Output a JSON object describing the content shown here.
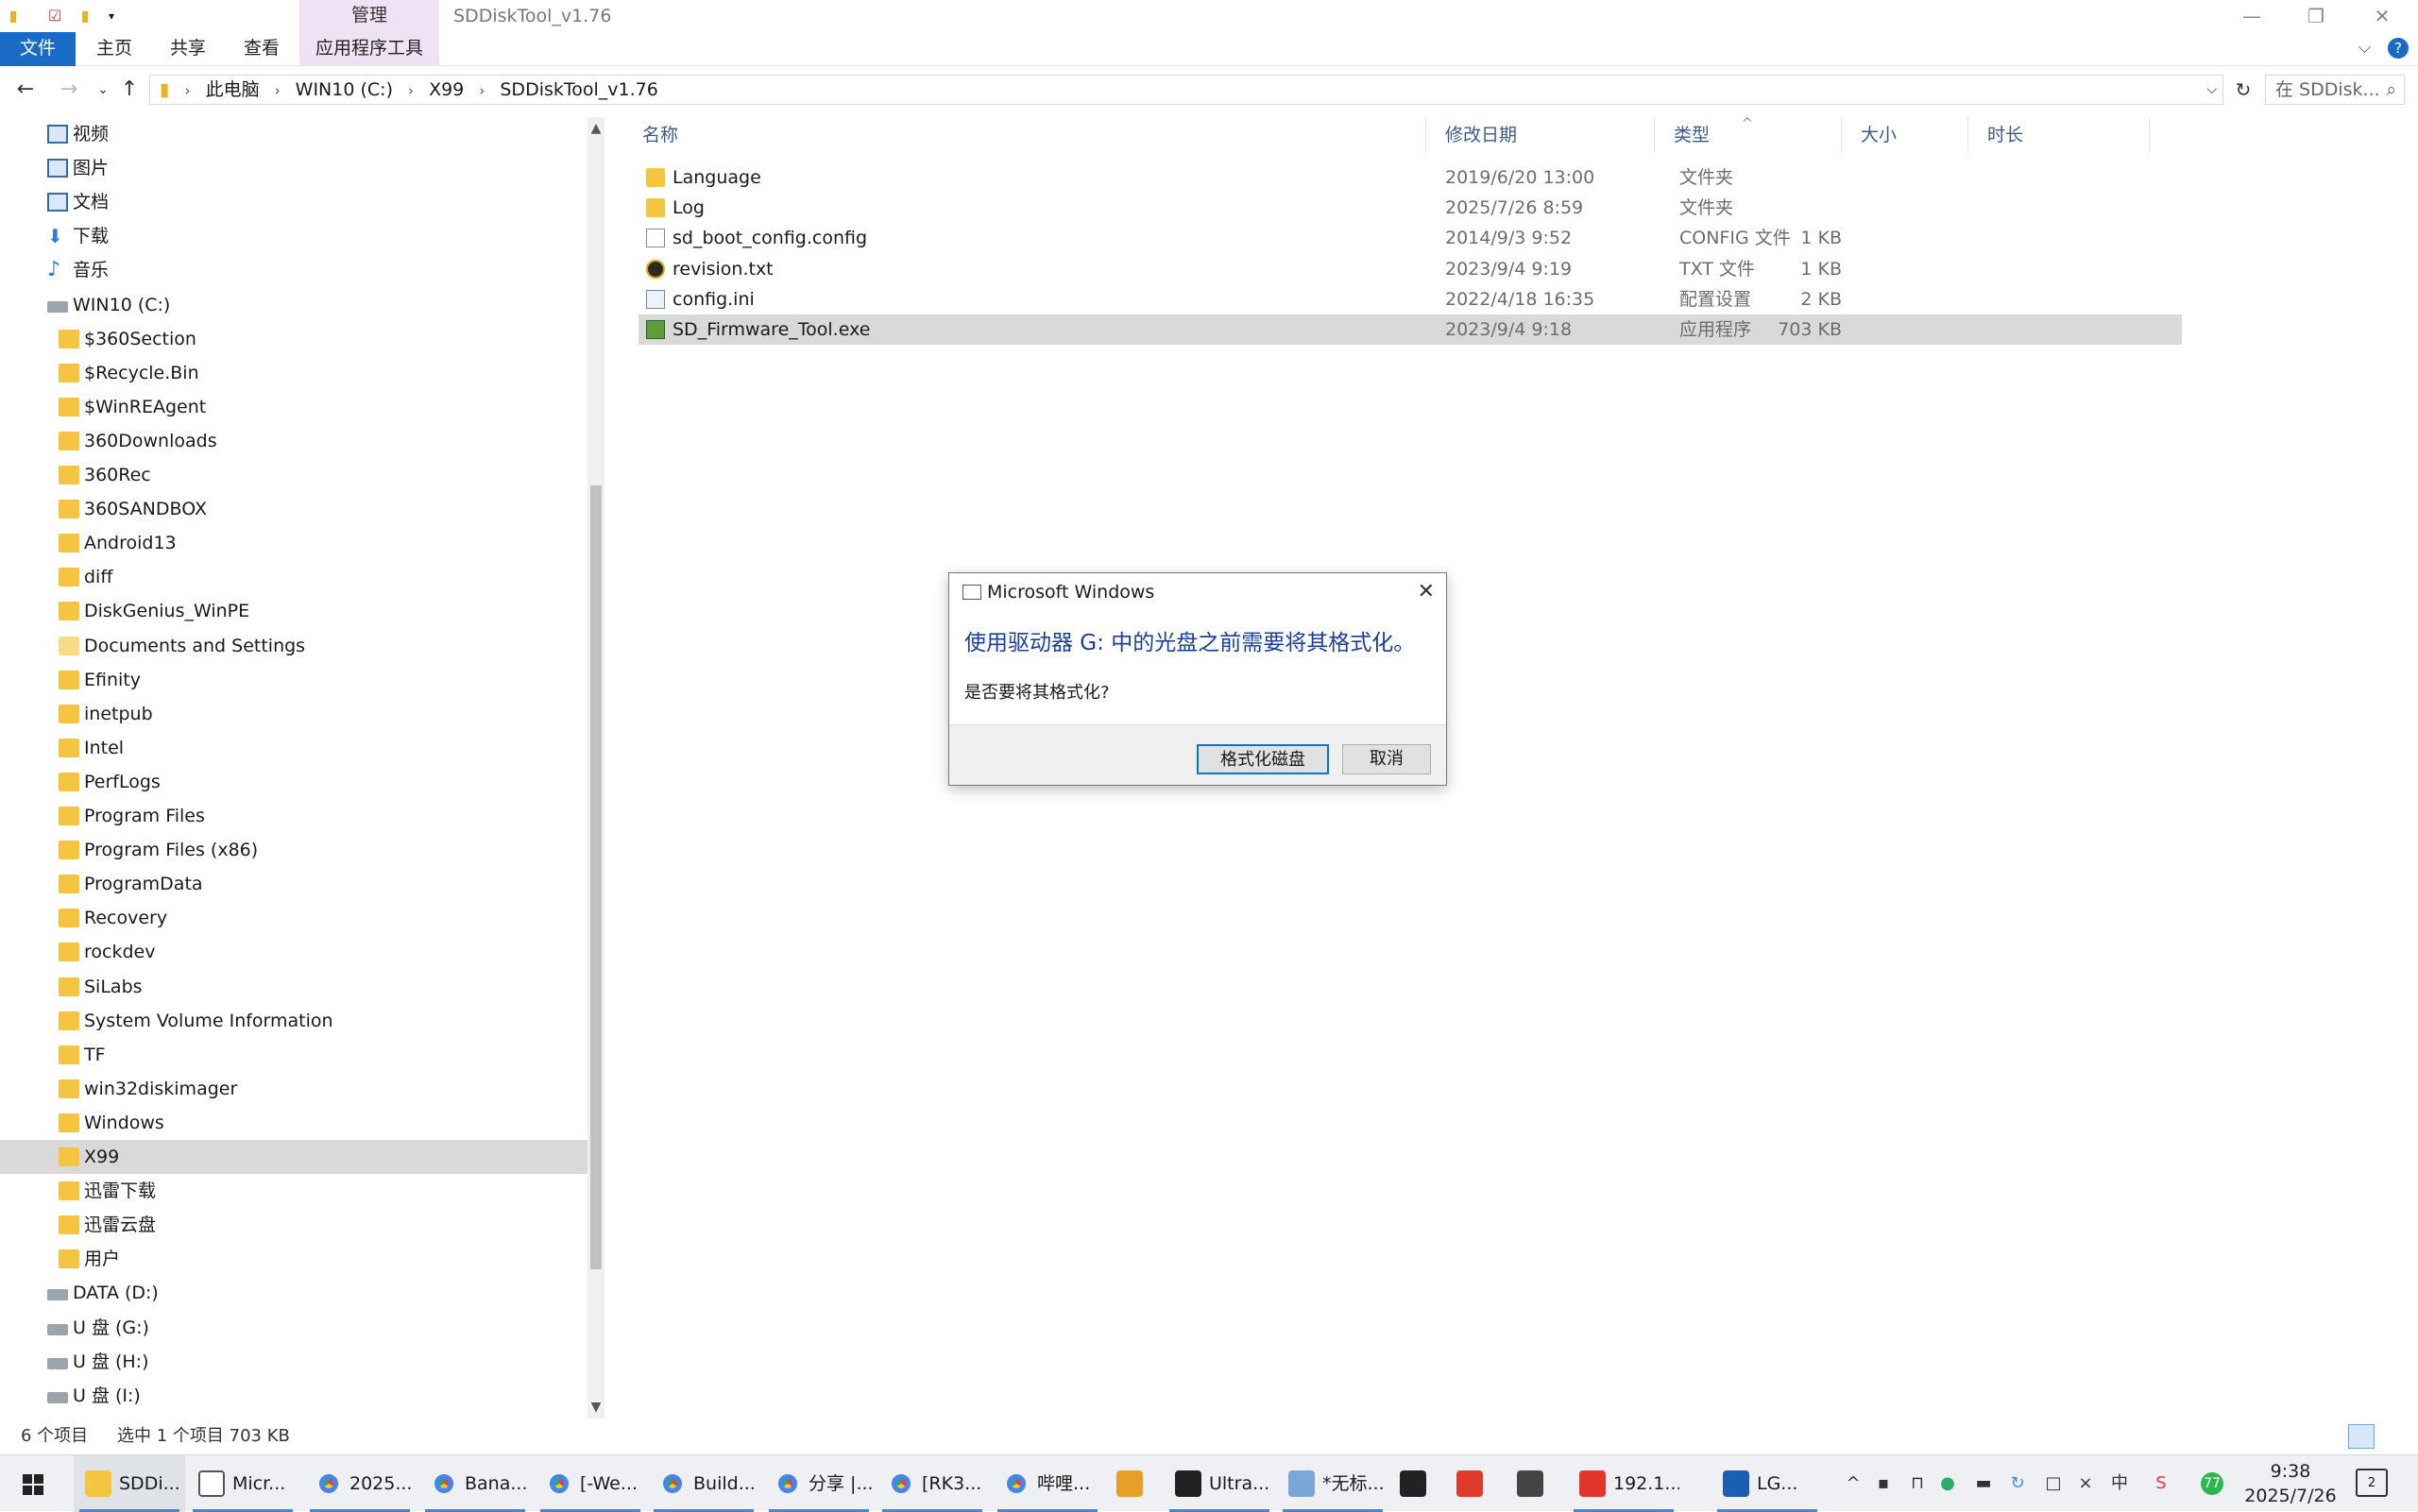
{
  "window": {
    "title": "SDDiskTool_v1.76",
    "manage_tab": "管理",
    "controls": {
      "minimize": "—",
      "restore": "❐",
      "close": "✕"
    }
  },
  "ribbon": {
    "tabs": [
      "文件",
      "主页",
      "共享",
      "查看",
      "应用程序工具"
    ],
    "expand": "⌵",
    "help": "?"
  },
  "address": {
    "crumbs": [
      "此电脑",
      "WIN10 (C:)",
      "X99",
      "SDDiskTool_v1.76"
    ],
    "search_placeholder": "在 SDDisk...",
    "refresh": "↻"
  },
  "navpane": {
    "items": [
      {
        "label": "视频",
        "icon": "library-video-icon",
        "indent": 1
      },
      {
        "label": "图片",
        "icon": "library-pictures-icon",
        "indent": 1
      },
      {
        "label": "文档",
        "icon": "library-documents-icon",
        "indent": 1
      },
      {
        "label": "下载",
        "icon": "download-arrow-icon",
        "indent": 1
      },
      {
        "label": "音乐",
        "icon": "music-note-icon",
        "indent": 1
      },
      {
        "label": "WIN10 (C:)",
        "icon": "windows-drive-icon",
        "indent": 1
      },
      {
        "label": "$360Section",
        "icon": "folder-icon",
        "indent": 2
      },
      {
        "label": "$Recycle.Bin",
        "icon": "folder-icon",
        "indent": 2
      },
      {
        "label": "$WinREAgent",
        "icon": "folder-icon",
        "indent": 2
      },
      {
        "label": "360Downloads",
        "icon": "folder-icon",
        "indent": 2
      },
      {
        "label": "360Rec",
        "icon": "folder-icon",
        "indent": 2
      },
      {
        "label": "360SANDBOX",
        "icon": "folder-icon",
        "indent": 2
      },
      {
        "label": "Android13",
        "icon": "folder-icon",
        "indent": 2
      },
      {
        "label": "diff",
        "icon": "folder-icon",
        "indent": 2
      },
      {
        "label": "DiskGenius_WinPE",
        "icon": "folder-icon",
        "indent": 2
      },
      {
        "label": "Documents and Settings",
        "icon": "shortcut-folder-icon",
        "indent": 2
      },
      {
        "label": "Efinity",
        "icon": "folder-icon",
        "indent": 2
      },
      {
        "label": "inetpub",
        "icon": "folder-icon",
        "indent": 2
      },
      {
        "label": "Intel",
        "icon": "folder-icon",
        "indent": 2
      },
      {
        "label": "PerfLogs",
        "icon": "folder-icon",
        "indent": 2
      },
      {
        "label": "Program Files",
        "icon": "folder-icon",
        "indent": 2
      },
      {
        "label": "Program Files (x86)",
        "icon": "folder-icon",
        "indent": 2
      },
      {
        "label": "ProgramData",
        "icon": "folder-icon",
        "indent": 2
      },
      {
        "label": "Recovery",
        "icon": "folder-icon",
        "indent": 2
      },
      {
        "label": "rockdev",
        "icon": "folder-icon",
        "indent": 2
      },
      {
        "label": "SiLabs",
        "icon": "folder-icon",
        "indent": 2
      },
      {
        "label": "System Volume Information",
        "icon": "folder-icon",
        "indent": 2
      },
      {
        "label": "TF",
        "icon": "folder-icon",
        "indent": 2
      },
      {
        "label": "win32diskimager",
        "icon": "folder-icon",
        "indent": 2
      },
      {
        "label": "Windows",
        "icon": "folder-icon",
        "indent": 2
      },
      {
        "label": "X99",
        "icon": "folder-icon",
        "indent": 2,
        "selected": true
      },
      {
        "label": "迅雷下载",
        "icon": "folder-icon",
        "indent": 2
      },
      {
        "label": "迅雷云盘",
        "icon": "folder-icon",
        "indent": 2
      },
      {
        "label": "用户",
        "icon": "folder-icon",
        "indent": 2
      },
      {
        "label": "DATA (D:)",
        "icon": "drive-icon",
        "indent": 1
      },
      {
        "label": "U 盘 (G:)",
        "icon": "usb-drive-icon",
        "indent": 1
      },
      {
        "label": "U 盘 (H:)",
        "icon": "usb-drive-icon",
        "indent": 1
      },
      {
        "label": "U 盘 (I:)",
        "icon": "usb-drive-icon",
        "indent": 1
      }
    ]
  },
  "filelist": {
    "columns": [
      "名称",
      "修改日期",
      "类型",
      "大小",
      "时长"
    ],
    "sort_indicator": "^",
    "rows": [
      {
        "name": "Language",
        "date": "2019/6/20 13:00",
        "type": "文件夹",
        "size": "",
        "icon": "folder"
      },
      {
        "name": "Log",
        "date": "2025/7/26 8:59",
        "type": "文件夹",
        "size": "",
        "icon": "folder"
      },
      {
        "name": "sd_boot_config.config",
        "date": "2014/9/3 9:52",
        "type": "CONFIG 文件",
        "size": "1 KB",
        "icon": "doc"
      },
      {
        "name": "revision.txt",
        "date": "2023/9/4 9:19",
        "type": "TXT 文件",
        "size": "1 KB",
        "icon": "ue"
      },
      {
        "name": "config.ini",
        "date": "2022/4/18 16:35",
        "type": "配置设置",
        "size": "2 KB",
        "icon": "ini"
      },
      {
        "name": "SD_Firmware_Tool.exe",
        "date": "2023/9/4 9:18",
        "type": "应用程序",
        "size": "703 KB",
        "icon": "exe",
        "selected": true
      }
    ]
  },
  "status": {
    "count": "6 个项目",
    "selection": "选中 1 个项目  703 KB"
  },
  "dialog": {
    "title": "Microsoft Windows",
    "close": "✕",
    "heading": "使用驱动器 G: 中的光盘之前需要将其格式化。",
    "question": "是否要将其格式化?",
    "format_button": "格式化磁盘",
    "cancel_button": "取消"
  },
  "taskbar": {
    "items": [
      {
        "label": "SDDi...",
        "icon": "explorer-icon",
        "active": true
      },
      {
        "label": "Micr...",
        "icon": "dialog-window-icon",
        "active": false
      },
      {
        "label": "2025...",
        "icon": "chrome-icon",
        "active": false
      },
      {
        "label": "Bana...",
        "icon": "chrome-icon",
        "active": false
      },
      {
        "label": "[-We...",
        "icon": "chrome-icon",
        "active": false
      },
      {
        "label": "Build...",
        "icon": "chrome-icon",
        "active": false
      },
      {
        "label": "分享 |...",
        "icon": "chrome-icon",
        "active": false
      },
      {
        "label": "[RK3...",
        "icon": "chrome-icon",
        "active": false
      },
      {
        "label": "哔哩...",
        "icon": "chrome-icon",
        "active": false
      },
      {
        "label": "",
        "icon": "paint-icon",
        "active": false
      },
      {
        "label": "Ultra...",
        "icon": "ultraedit-icon",
        "active": false
      },
      {
        "label": "*无标...",
        "icon": "notepad-icon",
        "active": false
      },
      {
        "label": "",
        "icon": "terminal-icon",
        "active": false
      },
      {
        "label": "",
        "icon": "wps-icon",
        "active": false
      },
      {
        "label": "",
        "icon": "obs-icon",
        "active": false
      },
      {
        "label": "192.1...",
        "icon": "remote-icon",
        "active": false
      },
      {
        "label": "LG...",
        "icon": "lg-icon",
        "active": false
      }
    ],
    "time": "9:38",
    "date": "2025/7/26",
    "tray": {
      "badge": "77",
      "notification": "2"
    }
  },
  "colors": {
    "file_tab": "#1a6bc5",
    "manage_tab": "#efe2f5",
    "dialog_heading": "#1a3f9b",
    "selection": "#d9d9d9"
  }
}
